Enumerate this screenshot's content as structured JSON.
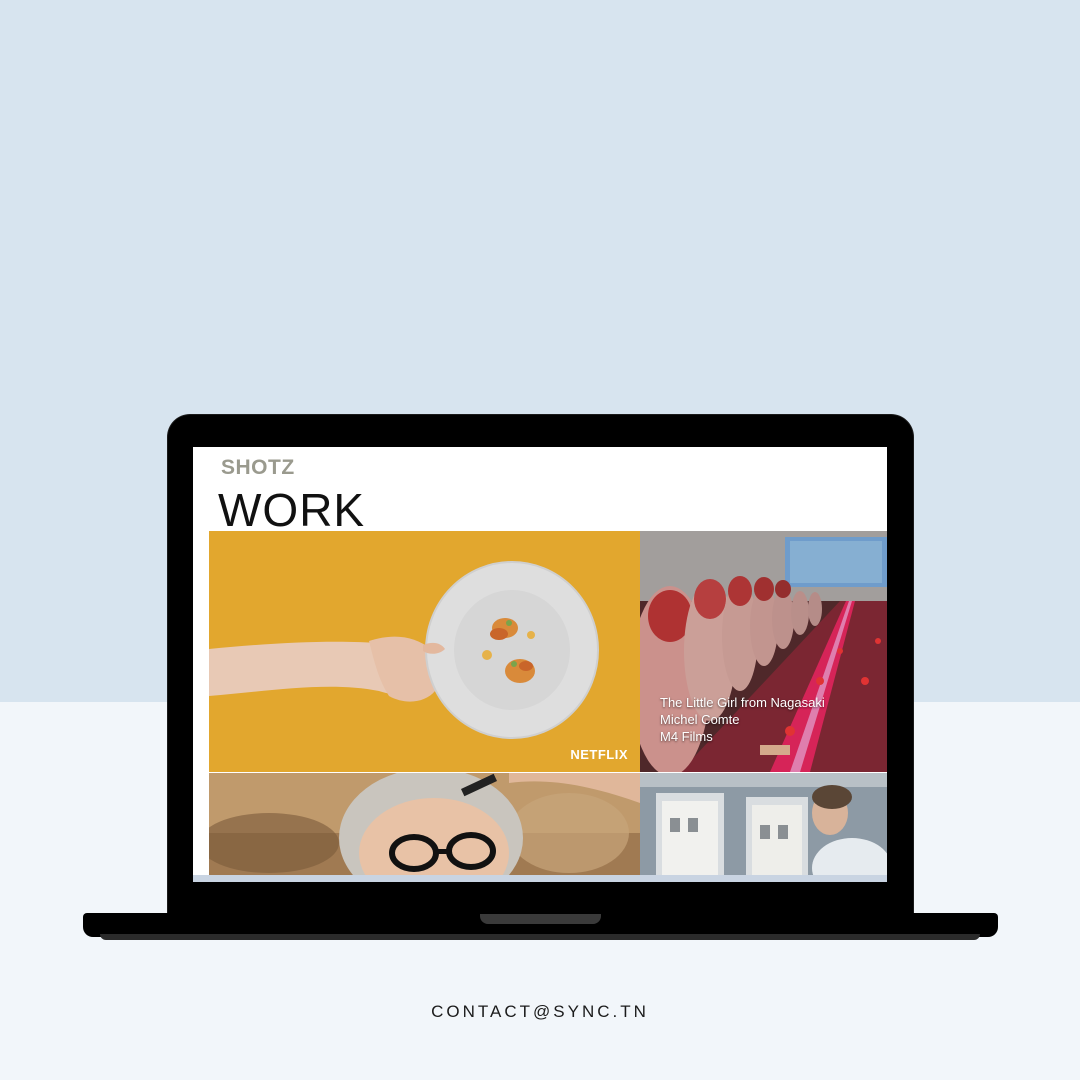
{
  "site": {
    "brand": "SHOTZ",
    "page_title": "WORK"
  },
  "tiles": [
    {
      "name": "netflix-plate",
      "overlay": "NETFLIX"
    },
    {
      "name": "nagasaki",
      "caption": [
        "The Little Girl from Nagasaki",
        "Michel Comte",
        "M4 Films"
      ]
    },
    {
      "name": "glasses-man"
    },
    {
      "name": "window-man"
    }
  ],
  "footer": {
    "contact": "CONTACT@SYNC.TN"
  },
  "colors": {
    "background_top": "#d7e4ef",
    "background_bottom": "#f2f6fa",
    "laptop": "#000000",
    "brand_text": "#9a9a8e",
    "plate_bg": "#e0a52b"
  }
}
